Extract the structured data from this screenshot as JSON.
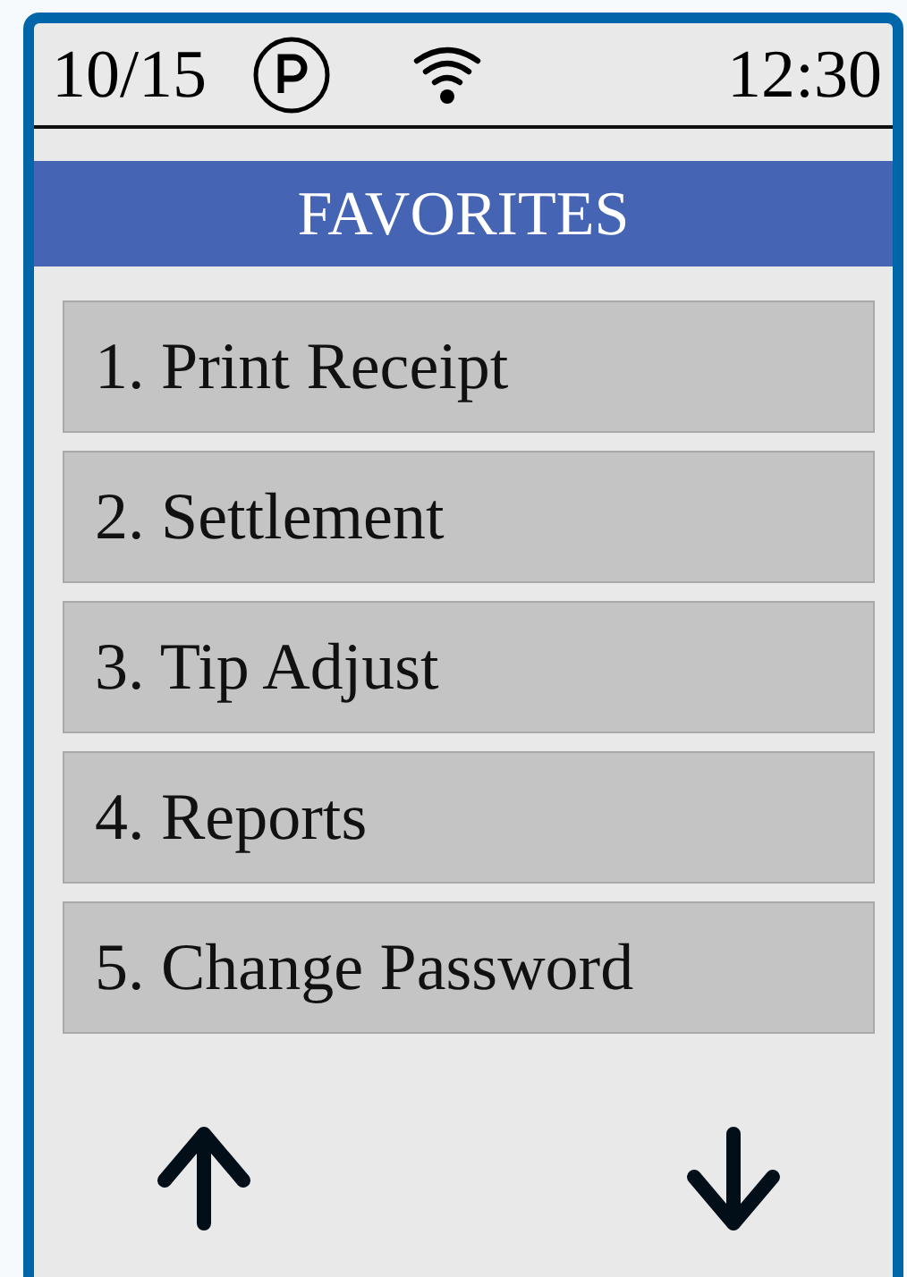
{
  "status_bar": {
    "date": "10/15",
    "time": "12:30"
  },
  "title": "FAVORITES",
  "menu_items": [
    {
      "label": "1. Print Receipt"
    },
    {
      "label": "2. Settlement"
    },
    {
      "label": "3. Tip Adjust"
    },
    {
      "label": "4. Reports"
    },
    {
      "label": "5. Change Password"
    }
  ]
}
